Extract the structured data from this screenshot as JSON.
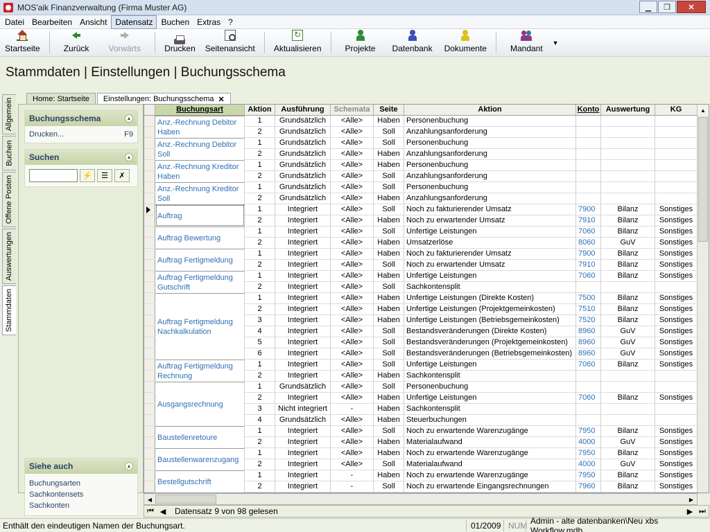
{
  "window": {
    "title": "MOS'aik Finanzverwaltung (Firma Muster AG)",
    "controls": [
      "minimize-icon",
      "maximize-icon",
      "close-icon"
    ]
  },
  "menu": [
    "Datei",
    "Bearbeiten",
    "Ansicht",
    "Datensatz",
    "Buchen",
    "Extras",
    "?"
  ],
  "menu_active": "Datensatz",
  "toolbar": {
    "home": "Startseite",
    "back": "Zurück",
    "forward": "Vorwärts",
    "print": "Drucken",
    "preview": "Seitenansicht",
    "refresh": "Aktualisieren",
    "projects": "Projekte",
    "database": "Datenbank",
    "documents": "Dokumente",
    "client": "Mandant"
  },
  "breadcrumb": "Stammdaten | Einstellungen | Buchungsschema",
  "vtabs": [
    "Allgemein",
    "Buchen",
    "Offene Posten",
    "Auswertungen",
    "Stammdaten"
  ],
  "vtab_active": "Stammdaten",
  "doc_tabs": [
    "Home: Startseite",
    "Einstellungen: Buchungsschema"
  ],
  "sidebar": {
    "schema_panel": {
      "title": "Buchungsschema",
      "action_label": "Drucken...",
      "action_key": "F9"
    },
    "search_panel": {
      "title": "Suchen",
      "value": ""
    },
    "see_also": {
      "title": "Siehe auch",
      "links": [
        "Buchungsarten",
        "Sachkontensets",
        "Sachkonten"
      ]
    }
  },
  "grid": {
    "columns": [
      "Buchungsart",
      "Aktion",
      "Ausführung",
      "Schemata",
      "Seite",
      "Aktion",
      "Konto",
      "Auswertung",
      "KG"
    ],
    "rows": [
      {
        "type": "Anz.-Rechnung Debitor Haben",
        "n": "1",
        "exec": "Grundsätzlich",
        "schemata": "<Alle>",
        "side": "Haben",
        "action": "Personenbuchung",
        "account": "",
        "eval": "",
        "kg": ""
      },
      {
        "type": "",
        "n": "2",
        "exec": "Grundsätzlich",
        "schemata": "<Alle>",
        "side": "Soll",
        "action": "Anzahlungsanforderung",
        "account": "",
        "eval": "",
        "kg": ""
      },
      {
        "type": "Anz.-Rechnung Debitor Soll",
        "n": "1",
        "exec": "Grundsätzlich",
        "schemata": "<Alle>",
        "side": "Soll",
        "action": "Personenbuchung",
        "account": "",
        "eval": "",
        "kg": ""
      },
      {
        "type": "",
        "n": "2",
        "exec": "Grundsätzlich",
        "schemata": "<Alle>",
        "side": "Haben",
        "action": "Anzahlungsanforderung",
        "account": "",
        "eval": "",
        "kg": ""
      },
      {
        "type": "Anz.-Rechnung Kreditor Haben",
        "n": "1",
        "exec": "Grundsätzlich",
        "schemata": "<Alle>",
        "side": "Haben",
        "action": "Personenbuchung",
        "account": "",
        "eval": "",
        "kg": ""
      },
      {
        "type": "",
        "n": "2",
        "exec": "Grundsätzlich",
        "schemata": "<Alle>",
        "side": "Soll",
        "action": "Anzahlungsanforderung",
        "account": "",
        "eval": "",
        "kg": ""
      },
      {
        "type": "Anz.-Rechnung Kreditor Soll",
        "n": "1",
        "exec": "Grundsätzlich",
        "schemata": "<Alle>",
        "side": "Soll",
        "action": "Personenbuchung",
        "account": "",
        "eval": "",
        "kg": ""
      },
      {
        "type": "",
        "n": "2",
        "exec": "Grundsätzlich",
        "schemata": "<Alle>",
        "side": "Haben",
        "action": "Anzahlungsanforderung",
        "account": "",
        "eval": "",
        "kg": ""
      },
      {
        "type": "Auftrag",
        "n": "1",
        "exec": "Integriert",
        "schemata": "<Alle>",
        "side": "Soll",
        "action": "Noch zu fakturierender Umsatz",
        "account": "7900",
        "eval": "Bilanz",
        "kg": "Sonstiges"
      },
      {
        "type": "",
        "n": "2",
        "exec": "Integriert",
        "schemata": "<Alle>",
        "side": "Haben",
        "action": "Noch zu erwartender Umsatz",
        "account": "7910",
        "eval": "Bilanz",
        "kg": "Sonstiges"
      },
      {
        "type": "Auftrag Bewertung",
        "n": "1",
        "exec": "Integriert",
        "schemata": "<Alle>",
        "side": "Soll",
        "action": "Unfertige Leistungen",
        "account": "7060",
        "eval": "Bilanz",
        "kg": "Sonstiges"
      },
      {
        "type": "",
        "n": "2",
        "exec": "Integriert",
        "schemata": "<Alle>",
        "side": "Haben",
        "action": "Umsatzerlöse",
        "account": "8060",
        "eval": "GuV",
        "kg": "Sonstiges"
      },
      {
        "type": "Auftrag Fertigmeldung",
        "n": "1",
        "exec": "Integriert",
        "schemata": "<Alle>",
        "side": "Haben",
        "action": "Noch zu fakturierender Umsatz",
        "account": "7900",
        "eval": "Bilanz",
        "kg": "Sonstiges"
      },
      {
        "type": "",
        "n": "2",
        "exec": "Integriert",
        "schemata": "<Alle>",
        "side": "Soll",
        "action": "Noch zu erwartender Umsatz",
        "account": "7910",
        "eval": "Bilanz",
        "kg": "Sonstiges"
      },
      {
        "type": "Auftrag Fertigmeldung Gutschrift",
        "n": "1",
        "exec": "Integriert",
        "schemata": "<Alle>",
        "side": "Haben",
        "action": "Unfertige Leistungen",
        "account": "7060",
        "eval": "Bilanz",
        "kg": "Sonstiges"
      },
      {
        "type": "",
        "n": "2",
        "exec": "Integriert",
        "schemata": "<Alle>",
        "side": "Soll",
        "action": "Sachkontensplit",
        "account": "",
        "eval": "",
        "kg": ""
      },
      {
        "type": "Auftrag Fertigmeldung Nachkalkulation",
        "n": "1",
        "exec": "Integriert",
        "schemata": "<Alle>",
        "side": "Haben",
        "action": "Unfertige Leistungen (Direkte Kosten)",
        "account": "7500",
        "eval": "Bilanz",
        "kg": "Sonstiges"
      },
      {
        "type": "",
        "n": "2",
        "exec": "Integriert",
        "schemata": "<Alle>",
        "side": "Haben",
        "action": "Unfertige Leistungen (Projektgemeinkosten)",
        "account": "7510",
        "eval": "Bilanz",
        "kg": "Sonstiges"
      },
      {
        "type": "",
        "n": "3",
        "exec": "Integriert",
        "schemata": "<Alle>",
        "side": "Haben",
        "action": "Unfertige Leistungen (Betriebsgemeinkosten)",
        "account": "7520",
        "eval": "Bilanz",
        "kg": "Sonstiges"
      },
      {
        "type": "",
        "n": "4",
        "exec": "Integriert",
        "schemata": "<Alle>",
        "side": "Soll",
        "action": "Bestandsveränderungen (Direkte Kosten)",
        "account": "8960",
        "eval": "GuV",
        "kg": "Sonstiges"
      },
      {
        "type": "",
        "n": "5",
        "exec": "Integriert",
        "schemata": "<Alle>",
        "side": "Soll",
        "action": "Bestandsveränderungen (Projektgemeinkosten)",
        "account": "8960",
        "eval": "GuV",
        "kg": "Sonstiges"
      },
      {
        "type": "",
        "n": "6",
        "exec": "Integriert",
        "schemata": "<Alle>",
        "side": "Soll",
        "action": "Bestandsveränderungen (Betriebsgemeinkosten)",
        "account": "8960",
        "eval": "GuV",
        "kg": "Sonstiges"
      },
      {
        "type": "Auftrag Fertigmeldung Rechnung",
        "n": "1",
        "exec": "Integriert",
        "schemata": "<Alle>",
        "side": "Soll",
        "action": "Unfertige Leistungen",
        "account": "7060",
        "eval": "Bilanz",
        "kg": "Sonstiges"
      },
      {
        "type": "",
        "n": "2",
        "exec": "Integriert",
        "schemata": "<Alle>",
        "side": "Haben",
        "action": "Sachkontensplit",
        "account": "",
        "eval": "",
        "kg": ""
      },
      {
        "type": "Ausgangsrechnung",
        "n": "1",
        "exec": "Grundsätzlich",
        "schemata": "<Alle>",
        "side": "Soll",
        "action": "Personenbuchung",
        "account": "",
        "eval": "",
        "kg": ""
      },
      {
        "type": "",
        "n": "2",
        "exec": "Integriert",
        "schemata": "<Alle>",
        "side": "Haben",
        "action": "Unfertige Leistungen",
        "account": "7060",
        "eval": "Bilanz",
        "kg": "Sonstiges"
      },
      {
        "type": "",
        "n": "3",
        "exec": "Nicht integriert",
        "schemata": "-",
        "side": "Haben",
        "action": "Sachkontensplit",
        "account": "",
        "eval": "",
        "kg": ""
      },
      {
        "type": "",
        "n": "4",
        "exec": "Grundsätzlich",
        "schemata": "<Alle>",
        "side": "Haben",
        "action": "Steuerbuchungen",
        "account": "",
        "eval": "",
        "kg": ""
      },
      {
        "type": "Baustellenretoure",
        "n": "1",
        "exec": "Integriert",
        "schemata": "<Alle>",
        "side": "Soll",
        "action": "Noch zu erwartende Warenzugänge",
        "account": "7950",
        "eval": "Bilanz",
        "kg": "Sonstiges"
      },
      {
        "type": "",
        "n": "2",
        "exec": "Integriert",
        "schemata": "<Alle>",
        "side": "Haben",
        "action": "Materialaufwand",
        "account": "4000",
        "eval": "GuV",
        "kg": "Sonstiges"
      },
      {
        "type": "Baustellenwarenzugang",
        "n": "1",
        "exec": "Integriert",
        "schemata": "<Alle>",
        "side": "Haben",
        "action": "Noch zu erwartende Warenzugänge",
        "account": "7950",
        "eval": "Bilanz",
        "kg": "Sonstiges"
      },
      {
        "type": "",
        "n": "2",
        "exec": "Integriert",
        "schemata": "<Alle>",
        "side": "Soll",
        "action": "Materialaufwand",
        "account": "4000",
        "eval": "GuV",
        "kg": "Sonstiges"
      },
      {
        "type": "Bestellgutschrift",
        "n": "1",
        "exec": "Integriert",
        "schemata": "-",
        "side": "Haben",
        "action": "Noch zu erwartende Warenzugänge",
        "account": "7950",
        "eval": "Bilanz",
        "kg": "Sonstiges"
      },
      {
        "type": "",
        "n": "2",
        "exec": "Integriert",
        "schemata": "-",
        "side": "Soll",
        "action": "Noch zu erwartende Eingangsrechnungen",
        "account": "7960",
        "eval": "Bilanz",
        "kg": "Sonstiges"
      }
    ]
  },
  "nav": {
    "status": "Datensatz 9 von 98 gelesen"
  },
  "statusbar": {
    "message": "Enthält den eindeutigen Namen der Buchungsart.",
    "period": "01/2009",
    "num": "NUM",
    "path": "Admin - alte datenbanken\\Neu xbs Workflow.mdb"
  }
}
